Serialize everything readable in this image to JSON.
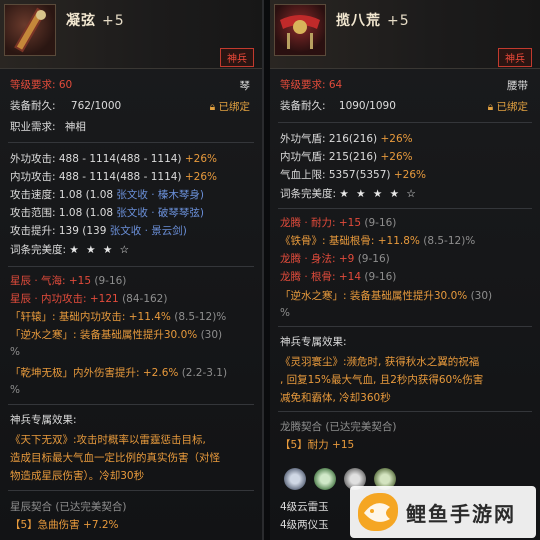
{
  "left": {
    "title": "凝弦",
    "plus": "+5",
    "rank": "神兵",
    "level_req": "等级要求: 60",
    "item_type": "琴",
    "durability_label": "装备耐久:",
    "durability": "762/1000",
    "bound": "已绑定",
    "class_label": "职业需求:",
    "class_val": "神相",
    "attrs": [
      {
        "a": "外功攻击: 488 - 1114(488 - 1114)",
        "b": " +26%"
      },
      {
        "a": "内功攻击: 488 - 1114(488 - 1114)",
        "b": " +26%"
      },
      {
        "a": "攻击速度: 1.08 (1.08 ",
        "b": "张文收 · 榛木琴身)"
      },
      {
        "a": "攻击范围: 1.08 (1.08 ",
        "b": "张文收 · 破琴琴弦)"
      },
      {
        "a": "攻击提升: 139 (139 ",
        "b": "张文收 · 景云剑)"
      }
    ],
    "perfection_label": "词条完美度:",
    "perfection_stars": "★ ★ ★ ☆",
    "stars": [
      {
        "a": "星辰 · 气海: +15",
        "b": " (9-16)"
      },
      {
        "a": "星辰 · 内功攻击: +121",
        "b": " (84-162)"
      },
      {
        "a": "「轩辕」: 基础内功攻击: +11.4%",
        "b": " (8.5-12)%"
      },
      {
        "a": "「逆水之寒」: 装备基础属性提升30.0%",
        "b": " (30)"
      },
      {
        "a": "%",
        "b": ""
      },
      {
        "a": "「乾坤无极」内外伤害提升: +2.6%",
        "b": " (2.2-3.1)"
      },
      {
        "a": "%",
        "b": ""
      }
    ],
    "effect_title": "神兵专属效果:",
    "effect_name": "《天下无双》:",
    "effect_text": [
      "攻击时概率以雷霆惩击目标,",
      "造成目标最大气血一定比例的真实伤害（对怪",
      "物造成星辰伤害）。冷却30秒"
    ],
    "set_title": "星辰契合 (已达完美契合)",
    "set_line_a": "【5】急曲伤害",
    "set_line_b": " +7.2%"
  },
  "right": {
    "title": "揽八荒",
    "plus": "+5",
    "rank": "神兵",
    "level_req": "等级要求: 64",
    "item_type": "腰带",
    "durability_label": "装备耐久:",
    "durability": "1090/1090",
    "bound": "已绑定",
    "attrs": [
      {
        "a": "外功气盾: 216(216)",
        "b": " +26%"
      },
      {
        "a": "内功气盾: 215(216)",
        "b": " +26%"
      },
      {
        "a": "气血上限: 5357(5357)",
        "b": " +26%"
      }
    ],
    "perfection_label": "词条完美度:",
    "perfection_stars": "★ ★ ★ ★ ☆",
    "stars": [
      {
        "a": "龙腾 · 耐力: +15",
        "b": " (9-16)"
      },
      {
        "a": "《铁骨》: 基础根骨: +11.8%",
        "b": " (8.5-12)%"
      },
      {
        "a": "龙腾 · 身法: +9",
        "b": " (9-16)"
      },
      {
        "a": "龙腾 · 根骨: +14",
        "b": " (9-16)"
      },
      {
        "a": "「逆水之寒」: 装备基础属性提升30.0%",
        "b": " (30)"
      },
      {
        "a": "%",
        "b": ""
      }
    ],
    "effect_title": "神兵专属效果:",
    "effect_name": "《灵羽寰尘》:",
    "effect_text": [
      "濒危时, 获得秋水之翼的祝福",
      ", 回复15%最大气血, 且2秒内获得60%伤害",
      "减免和霸体, 冷却360秒"
    ],
    "set_title": "龙腾契合 (已达完美契合)",
    "set_line_a": "【5】耐力",
    "set_line_b": " +15",
    "jade_lines": [
      "4级云雷玉",
      "4级两仪玉"
    ]
  },
  "watermark": {
    "text": "鲤鱼手游网"
  },
  "colors": {
    "red": "#e24b3b",
    "gold": "#e0a040",
    "blue": "#6a8fd8",
    "panel": "#1a1b1d"
  }
}
